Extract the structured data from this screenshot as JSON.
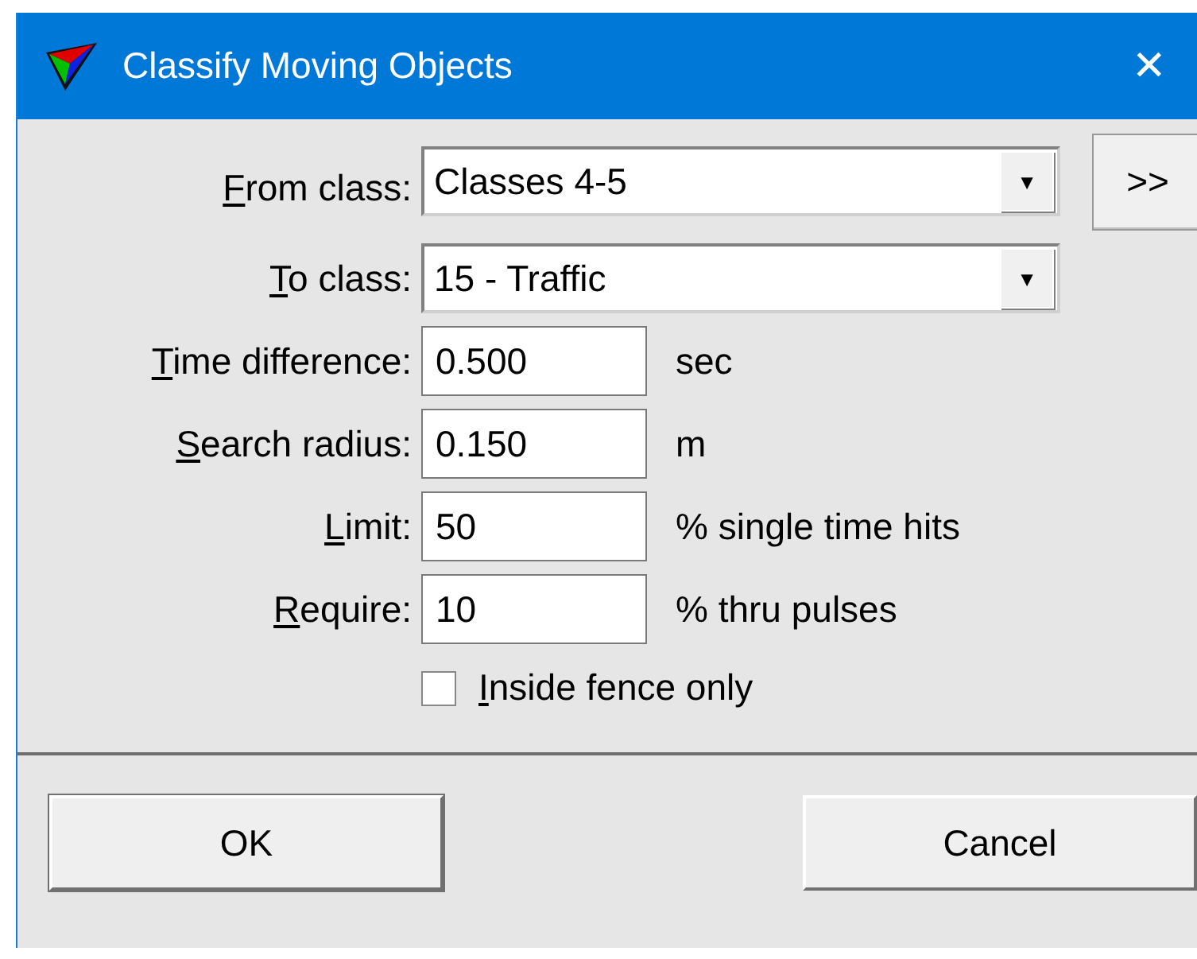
{
  "window": {
    "title": "Classify Moving Objects",
    "close": "✕"
  },
  "combos": [
    {
      "label": {
        "accel": "F",
        "rest": "rom class:"
      },
      "value": "Classes 4-5",
      "arrow": "▼"
    },
    {
      "label": {
        "accel": "T",
        "rest": "o class:"
      },
      "value": "15 - Traffic",
      "arrow": "▼"
    }
  ],
  "more_button": ">>",
  "fields": [
    {
      "label": {
        "accel": "T",
        "rest": "ime difference:"
      },
      "value": "0.500",
      "unit": "sec"
    },
    {
      "label": {
        "accel": "S",
        "rest": "earch radius:"
      },
      "value": "0.150",
      "unit": "m"
    },
    {
      "label": {
        "accel": "L",
        "rest": "imit:"
      },
      "value": "50",
      "unit": "% single time hits"
    },
    {
      "label": {
        "accel": "R",
        "rest": "equire:"
      },
      "value": "10",
      "unit": "% thru pulses"
    }
  ],
  "checkbox": {
    "label": {
      "accel": "I",
      "rest": "nside fence only"
    },
    "checked": false
  },
  "buttons": [
    "OK",
    "Cancel"
  ]
}
